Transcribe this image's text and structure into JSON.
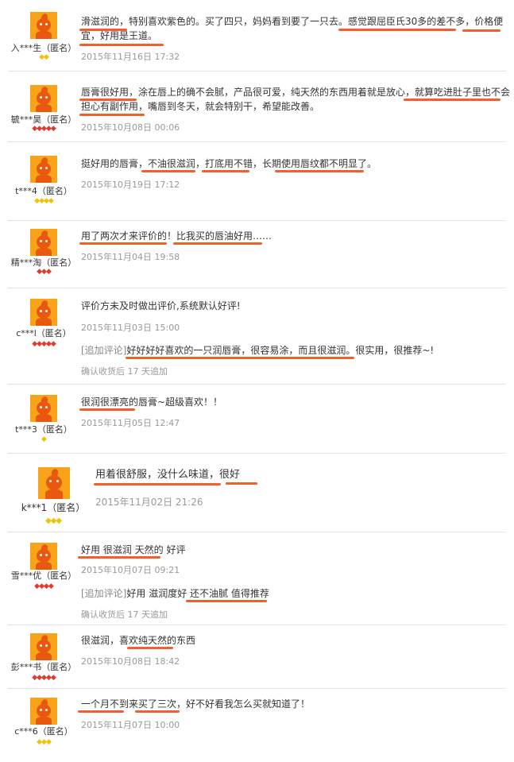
{
  "reviews": [
    {
      "user": "入***生（匿名）",
      "text_lines": [
        "滑滋润的，特别喜欢紫色的。买了四只，妈妈看到要了一只去。感觉跟屈臣氏30多的差不多，价格便",
        "宜，好用是王道。"
      ],
      "date": "2015年11月16日 17:32",
      "badge_level": "gold-2"
    },
    {
      "user": "毓***昊（匿名）",
      "text_lines": [
        "唇膏很好用，涂在唇上的确不会腻，产品很可爱，纯天然的东西用着就是放心，就算吃进肚子里也不会",
        "担心有副作用，嘴唇到冬天，就会特别干，希望能改善。"
      ],
      "date": "2015年10月08日 00:06",
      "badge_level": "red-5"
    },
    {
      "user": "t***4（匿名）",
      "text_lines": [
        "挺好用的唇膏，不油很滋润，打底用不错，长期使用唇纹都不明显了。"
      ],
      "date": "2015年10月19日 17:12",
      "badge_level": "gold-4"
    },
    {
      "user": "精***淘（匿名）",
      "text_lines": [
        "用了两次才来评价的！比我买的唇油好用……"
      ],
      "date": "2015年11月04日 19:58",
      "badge_level": "red-3"
    },
    {
      "user": "c***l（匿名）",
      "text_lines": [
        "评价方未及时做出评价,系统默认好评!"
      ],
      "date": "2015年11月03日 15:00",
      "badge_level": "red-5",
      "followup_tag": "[追加评论]",
      "followup_text": "好好好好喜欢的一只润唇膏，很容易涂，而且很滋润。很实用，很推荐~!",
      "followup_meta": "确认收货后 17 天追加"
    },
    {
      "user": "t***3（匿名）",
      "text_lines": [
        "很润很漂亮的唇膏~超级喜欢！！"
      ],
      "date": "2015年11月05日 12:47",
      "badge_level": "gold-1"
    },
    {
      "user": "k***1（匿名）",
      "text_lines": [
        "用着很舒服，没什么味道，很好"
      ],
      "date": "2015年11月02日 21:26",
      "badge_level": "gold-3"
    },
    {
      "user": "雪***优（匿名）",
      "text_lines": [
        "好用 很滋润 天然的 好评"
      ],
      "date": "2015年10月07日 09:21",
      "badge_level": "red-4",
      "followup_tag": "[追加评论]",
      "followup_text": "好用 滋润度好 还不油腻 值得推荐",
      "followup_meta": "确认收货后 17 天追加"
    },
    {
      "user": "彭***书（匿名）",
      "text_lines": [
        "很滋润，喜欢纯天然的东西"
      ],
      "date": "2015年10月08日 18:42",
      "badge_level": "red-5"
    },
    {
      "user": "c***6（匿名）",
      "text_lines": [
        "一个月不到来买了三次，好不好看我怎么买就知道了！"
      ],
      "date": "2015年11月07日 10:00",
      "badge_level": "gold-3"
    }
  ],
  "colors": {
    "underline": "#f0602c",
    "avatar_bg": "#f9a31a",
    "badge_gold": "#f2c200",
    "badge_red": "#e13a2c"
  }
}
